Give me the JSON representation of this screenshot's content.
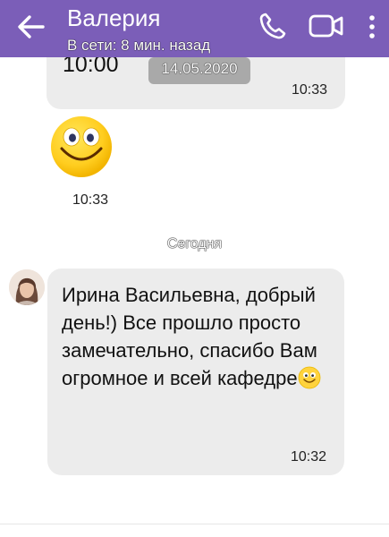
{
  "header": {
    "contact_name": "Валерия",
    "status": "В сети: 8 мин. назад",
    "icons": [
      "back-arrow-icon",
      "phone-icon",
      "video-call-icon",
      "more-vert-icon"
    ],
    "bar_color": "#7b5eb8"
  },
  "messages": {
    "prev": {
      "text": "10:00",
      "date_chip": "14.05.2020",
      "time": "10:33"
    },
    "sticker": {
      "icon": "smiley-face-icon",
      "time": "10:33"
    },
    "day_separator": "Сегодня",
    "main": {
      "text": "Ирина Васильевна, добрый день!) Все прошло просто замечательно, спасибо Вам огромное и всей кафедре",
      "emoji": "smiling-face-icon",
      "time": "10:32"
    }
  },
  "colors": {
    "bubble": "#ececec",
    "date_chip": "#a9a9a9"
  }
}
